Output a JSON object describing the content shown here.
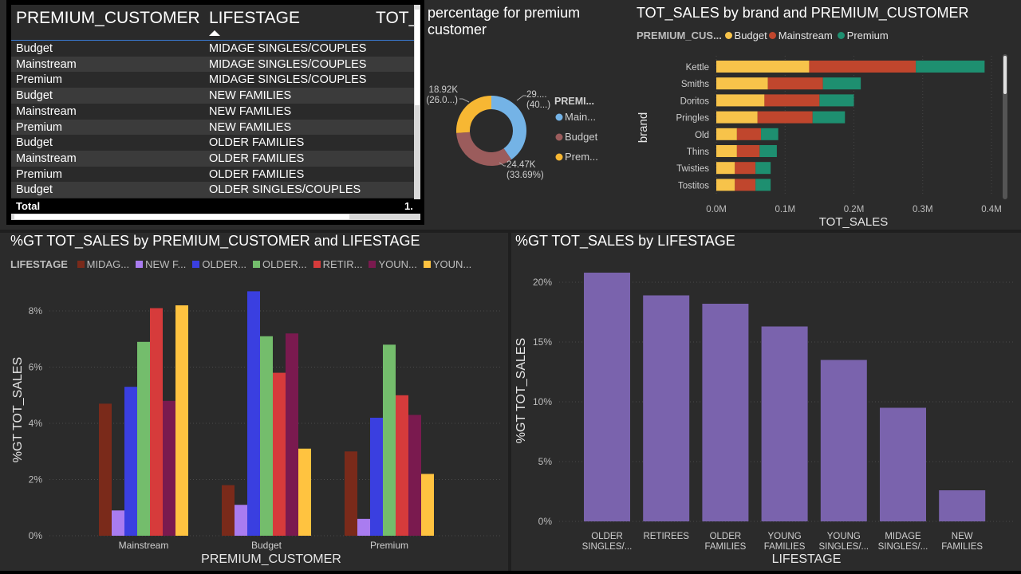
{
  "table": {
    "headers": [
      "PREMIUM_CUSTOMER",
      "LIFESTAGE",
      "TOT_"
    ],
    "rows": [
      [
        "Budget",
        "MIDAGE SINGLES/COUPLES"
      ],
      [
        "Mainstream",
        "MIDAGE SINGLES/COUPLES"
      ],
      [
        "Premium",
        "MIDAGE SINGLES/COUPLES"
      ],
      [
        "Budget",
        "NEW FAMILIES"
      ],
      [
        "Mainstream",
        "NEW FAMILIES"
      ],
      [
        "Premium",
        "NEW FAMILIES"
      ],
      [
        "Budget",
        "OLDER FAMILIES"
      ],
      [
        "Mainstream",
        "OLDER FAMILIES"
      ],
      [
        "Premium",
        "OLDER FAMILIES"
      ],
      [
        "Budget",
        "OLDER SINGLES/COUPLES"
      ]
    ],
    "total_label": "Total",
    "total_value": "1."
  },
  "donut": {
    "title": "percentage for premium customer",
    "title_line1": "percentage for premium",
    "title_line2": "customer",
    "legend_title": "PREMI...",
    "legend": [
      "Main...",
      "Budget",
      "Prem..."
    ],
    "colors": [
      "#74b3e6",
      "#9b5c5c",
      "#f7b733"
    ],
    "labels": [
      {
        "l1": "29....",
        "l2": "(40...)"
      },
      {
        "l1": "24.47K",
        "l2": "(33.69%)"
      },
      {
        "l1": "18.92K",
        "l2": "(26.0...)"
      }
    ]
  },
  "brand_chart": {
    "title": "TOT_SALES by brand and PREMIUM_CUSTOMER",
    "legend_title": "PREMIUM_CUS...",
    "legend": [
      "Budget",
      "Mainstream",
      "Premium"
    ],
    "colors": [
      "#f7c34a",
      "#c0462d",
      "#1e8f70"
    ]
  },
  "lifestage_customer_chart": {
    "title": "%GT TOT_SALES by PREMIUM_CUSTOMER and LIFESTAGE",
    "legend_title": "LIFESTAGE",
    "legend": [
      "MIDAG...",
      "NEW F...",
      "OLDER...",
      "OLDER...",
      "RETIR...",
      "YOUN...",
      "YOUN..."
    ],
    "colors": [
      "#7a2a1a",
      "#a97cf0",
      "#3a3fe0",
      "#74bd6c",
      "#d63b3b",
      "#7a1a4f",
      "#ffc340"
    ]
  },
  "lifestage_chart": {
    "title": "%GT TOT_SALES by LIFESTAGE",
    "bar_color": "#7a63ad"
  },
  "chart_data": [
    {
      "type": "pie",
      "title": "percentage for premium customer",
      "categories": [
        "Mainstream",
        "Budget",
        "Premium"
      ],
      "values": [
        29.3,
        24.47,
        18.92
      ],
      "percent": [
        40.3,
        33.69,
        26.0
      ]
    },
    {
      "type": "bar",
      "orientation": "horizontal",
      "stacked": true,
      "title": "TOT_SALES by brand and PREMIUM_CUSTOMER",
      "xlabel": "TOT_SALES",
      "ylabel": "brand",
      "categories": [
        "Kettle",
        "Smiths",
        "Doritos",
        "Pringles",
        "Old",
        "Thins",
        "Twisties",
        "Tostitos"
      ],
      "series": [
        {
          "name": "Budget",
          "values": [
            0.135,
            0.075,
            0.07,
            0.06,
            0.03,
            0.03,
            0.027,
            0.027
          ]
        },
        {
          "name": "Mainstream",
          "values": [
            0.155,
            0.08,
            0.08,
            0.08,
            0.035,
            0.033,
            0.03,
            0.03
          ]
        },
        {
          "name": "Premium",
          "values": [
            0.1,
            0.055,
            0.05,
            0.047,
            0.025,
            0.025,
            0.022,
            0.022
          ]
        }
      ],
      "xticks": [
        "0.0M",
        "0.1M",
        "0.2M",
        "0.3M",
        "0.4M"
      ],
      "xlim": [
        0,
        0.4
      ]
    },
    {
      "type": "bar",
      "title": "%GT TOT_SALES by PREMIUM_CUSTOMER and LIFESTAGE",
      "xlabel": "PREMIUM_CUSTOMER",
      "ylabel": "%GT TOT_SALES",
      "categories": [
        "Mainstream",
        "Budget",
        "Premium"
      ],
      "series": [
        {
          "name": "MIDAG...",
          "values": [
            4.7,
            1.8,
            3.0
          ]
        },
        {
          "name": "NEW F...",
          "values": [
            0.9,
            1.1,
            0.6
          ]
        },
        {
          "name": "OLDER...",
          "values": [
            5.3,
            8.7,
            4.2
          ]
        },
        {
          "name": "OLDER...",
          "values": [
            6.9,
            7.1,
            6.8
          ]
        },
        {
          "name": "RETIR...",
          "values": [
            8.1,
            5.8,
            5.0
          ]
        },
        {
          "name": "YOUN...",
          "values": [
            4.8,
            7.2,
            4.3
          ]
        },
        {
          "name": "YOUN...",
          "values": [
            8.2,
            3.1,
            2.2
          ]
        }
      ],
      "yticks": [
        "0%",
        "2%",
        "4%",
        "6%",
        "8%"
      ],
      "ylim": [
        0,
        9
      ]
    },
    {
      "type": "bar",
      "title": "%GT TOT_SALES by LIFESTAGE",
      "xlabel": "LIFESTAGE",
      "ylabel": "%GT TOT_SALES",
      "categories": [
        "OLDER SINGLES/...",
        "RETIREES",
        "OLDER FAMILIES",
        "YOUNG FAMILIES",
        "YOUNG SINGLES/...",
        "MIDAGE SINGLES/...",
        "NEW FAMILIES"
      ],
      "category_lines": [
        [
          "OLDER",
          "SINGLES/..."
        ],
        [
          "RETIREES"
        ],
        [
          "OLDER",
          "FAMILIES"
        ],
        [
          "YOUNG",
          "FAMILIES"
        ],
        [
          "YOUNG",
          "SINGLES/..."
        ],
        [
          "MIDAGE",
          "SINGLES/..."
        ],
        [
          "NEW",
          "FAMILIES"
        ]
      ],
      "values": [
        20.8,
        18.9,
        18.2,
        16.3,
        13.5,
        9.5,
        2.6
      ],
      "yticks": [
        "0%",
        "5%",
        "10%",
        "15%",
        "20%"
      ],
      "ylim": [
        0,
        22
      ]
    }
  ]
}
